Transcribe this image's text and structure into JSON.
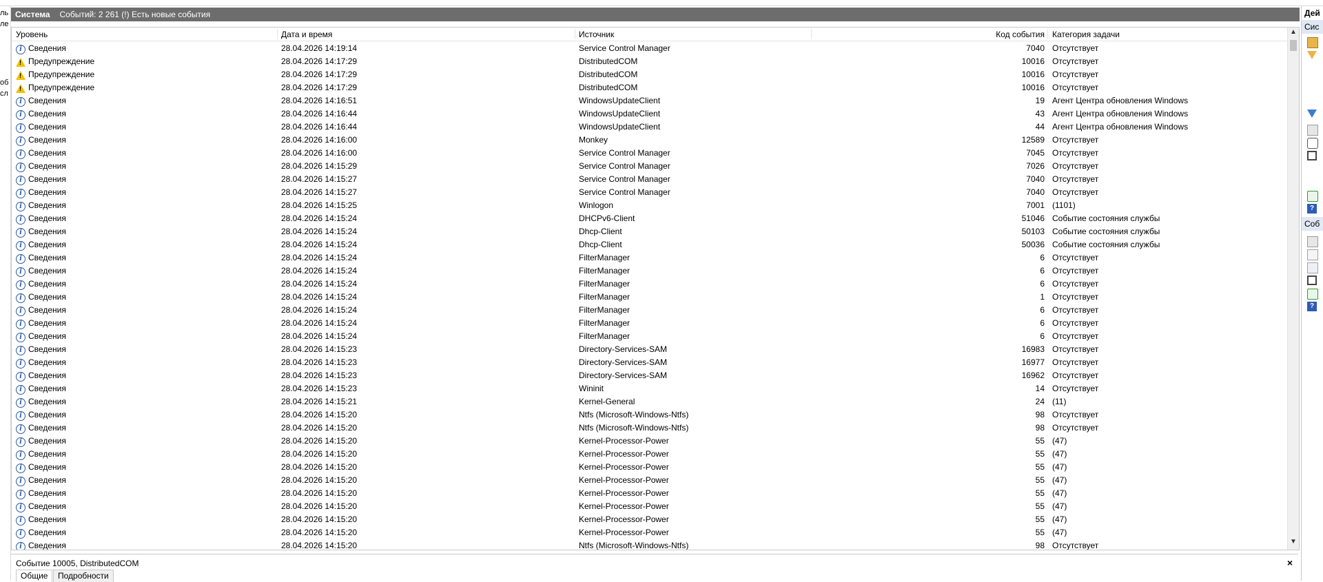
{
  "left_panel": {
    "fragments": [
      "ль",
      "ле",
      "об",
      "сл"
    ]
  },
  "log": {
    "title": "Система",
    "event_count": "Событий: 2 261 (!) Есть новые события"
  },
  "columns": {
    "level": "Уровень",
    "date": "Дата и время",
    "source": "Источник",
    "code": "Код события",
    "category": "Категория задачи"
  },
  "rows": [
    {
      "type": "info",
      "level": "Сведения",
      "date": "28.04.2026 14:19:14",
      "source": "Service Control Manager",
      "code": "7040",
      "category": "Отсутствует"
    },
    {
      "type": "warn",
      "level": "Предупреждение",
      "date": "28.04.2026 14:17:29",
      "source": "DistributedCOM",
      "code": "10016",
      "category": "Отсутствует"
    },
    {
      "type": "warn",
      "level": "Предупреждение",
      "date": "28.04.2026 14:17:29",
      "source": "DistributedCOM",
      "code": "10016",
      "category": "Отсутствует"
    },
    {
      "type": "warn",
      "level": "Предупреждение",
      "date": "28.04.2026 14:17:29",
      "source": "DistributedCOM",
      "code": "10016",
      "category": "Отсутствует"
    },
    {
      "type": "info",
      "level": "Сведения",
      "date": "28.04.2026 14:16:51",
      "source": "WindowsUpdateClient",
      "code": "19",
      "category": "Агент Центра обновления Windows"
    },
    {
      "type": "info",
      "level": "Сведения",
      "date": "28.04.2026 14:16:44",
      "source": "WindowsUpdateClient",
      "code": "43",
      "category": "Агент Центра обновления Windows"
    },
    {
      "type": "info",
      "level": "Сведения",
      "date": "28.04.2026 14:16:44",
      "source": "WindowsUpdateClient",
      "code": "44",
      "category": "Агент Центра обновления Windows"
    },
    {
      "type": "info",
      "level": "Сведения",
      "date": "28.04.2026 14:16:00",
      "source": "Monkey",
      "code": "12589",
      "category": "Отсутствует"
    },
    {
      "type": "info",
      "level": "Сведения",
      "date": "28.04.2026 14:16:00",
      "source": "Service Control Manager",
      "code": "7045",
      "category": "Отсутствует"
    },
    {
      "type": "info",
      "level": "Сведения",
      "date": "28.04.2026 14:15:29",
      "source": "Service Control Manager",
      "code": "7026",
      "category": "Отсутствует"
    },
    {
      "type": "info",
      "level": "Сведения",
      "date": "28.04.2026 14:15:27",
      "source": "Service Control Manager",
      "code": "7040",
      "category": "Отсутствует"
    },
    {
      "type": "info",
      "level": "Сведения",
      "date": "28.04.2026 14:15:27",
      "source": "Service Control Manager",
      "code": "7040",
      "category": "Отсутствует"
    },
    {
      "type": "info",
      "level": "Сведения",
      "date": "28.04.2026 14:15:25",
      "source": "Winlogon",
      "code": "7001",
      "category": "(1101)"
    },
    {
      "type": "info",
      "level": "Сведения",
      "date": "28.04.2026 14:15:24",
      "source": "DHCPv6-Client",
      "code": "51046",
      "category": "Событие состояния службы"
    },
    {
      "type": "info",
      "level": "Сведения",
      "date": "28.04.2026 14:15:24",
      "source": "Dhcp-Client",
      "code": "50103",
      "category": "Событие состояния службы"
    },
    {
      "type": "info",
      "level": "Сведения",
      "date": "28.04.2026 14:15:24",
      "source": "Dhcp-Client",
      "code": "50036",
      "category": "Событие состояния службы"
    },
    {
      "type": "info",
      "level": "Сведения",
      "date": "28.04.2026 14:15:24",
      "source": "FilterManager",
      "code": "6",
      "category": "Отсутствует"
    },
    {
      "type": "info",
      "level": "Сведения",
      "date": "28.04.2026 14:15:24",
      "source": "FilterManager",
      "code": "6",
      "category": "Отсутствует"
    },
    {
      "type": "info",
      "level": "Сведения",
      "date": "28.04.2026 14:15:24",
      "source": "FilterManager",
      "code": "6",
      "category": "Отсутствует"
    },
    {
      "type": "info",
      "level": "Сведения",
      "date": "28.04.2026 14:15:24",
      "source": "FilterManager",
      "code": "1",
      "category": "Отсутствует"
    },
    {
      "type": "info",
      "level": "Сведения",
      "date": "28.04.2026 14:15:24",
      "source": "FilterManager",
      "code": "6",
      "category": "Отсутствует"
    },
    {
      "type": "info",
      "level": "Сведения",
      "date": "28.04.2026 14:15:24",
      "source": "FilterManager",
      "code": "6",
      "category": "Отсутствует"
    },
    {
      "type": "info",
      "level": "Сведения",
      "date": "28.04.2026 14:15:24",
      "source": "FilterManager",
      "code": "6",
      "category": "Отсутствует"
    },
    {
      "type": "info",
      "level": "Сведения",
      "date": "28.04.2026 14:15:23",
      "source": "Directory-Services-SAM",
      "code": "16983",
      "category": "Отсутствует"
    },
    {
      "type": "info",
      "level": "Сведения",
      "date": "28.04.2026 14:15:23",
      "source": "Directory-Services-SAM",
      "code": "16977",
      "category": "Отсутствует"
    },
    {
      "type": "info",
      "level": "Сведения",
      "date": "28.04.2026 14:15:23",
      "source": "Directory-Services-SAM",
      "code": "16962",
      "category": "Отсутствует"
    },
    {
      "type": "info",
      "level": "Сведения",
      "date": "28.04.2026 14:15:23",
      "source": "Wininit",
      "code": "14",
      "category": "Отсутствует"
    },
    {
      "type": "info",
      "level": "Сведения",
      "date": "28.04.2026 14:15:21",
      "source": "Kernel-General",
      "code": "24",
      "category": "(11)"
    },
    {
      "type": "info",
      "level": "Сведения",
      "date": "28.04.2026 14:15:20",
      "source": "Ntfs (Microsoft-Windows-Ntfs)",
      "code": "98",
      "category": "Отсутствует"
    },
    {
      "type": "info",
      "level": "Сведения",
      "date": "28.04.2026 14:15:20",
      "source": "Ntfs (Microsoft-Windows-Ntfs)",
      "code": "98",
      "category": "Отсутствует"
    },
    {
      "type": "info",
      "level": "Сведения",
      "date": "28.04.2026 14:15:20",
      "source": "Kernel-Processor-Power",
      "code": "55",
      "category": "(47)"
    },
    {
      "type": "info",
      "level": "Сведения",
      "date": "28.04.2026 14:15:20",
      "source": "Kernel-Processor-Power",
      "code": "55",
      "category": "(47)"
    },
    {
      "type": "info",
      "level": "Сведения",
      "date": "28.04.2026 14:15:20",
      "source": "Kernel-Processor-Power",
      "code": "55",
      "category": "(47)"
    },
    {
      "type": "info",
      "level": "Сведения",
      "date": "28.04.2026 14:15:20",
      "source": "Kernel-Processor-Power",
      "code": "55",
      "category": "(47)"
    },
    {
      "type": "info",
      "level": "Сведения",
      "date": "28.04.2026 14:15:20",
      "source": "Kernel-Processor-Power",
      "code": "55",
      "category": "(47)"
    },
    {
      "type": "info",
      "level": "Сведения",
      "date": "28.04.2026 14:15:20",
      "source": "Kernel-Processor-Power",
      "code": "55",
      "category": "(47)"
    },
    {
      "type": "info",
      "level": "Сведения",
      "date": "28.04.2026 14:15:20",
      "source": "Kernel-Processor-Power",
      "code": "55",
      "category": "(47)"
    },
    {
      "type": "info",
      "level": "Сведения",
      "date": "28.04.2026 14:15:20",
      "source": "Kernel-Processor-Power",
      "code": "55",
      "category": "(47)"
    },
    {
      "type": "info",
      "level": "Сведения",
      "date": "28.04.2026 14:15:20",
      "source": "Ntfs (Microsoft-Windows-Ntfs)",
      "code": "98",
      "category": "Отсутствует"
    }
  ],
  "detail": {
    "title": "Событие 10005, DistributedCOM",
    "close": "×",
    "tabs": [
      "Общие",
      "Подробности"
    ]
  },
  "actions": {
    "header": "Дей",
    "section1": "Сис",
    "section2": "Соб",
    "help_glyph": "?"
  },
  "icons": {
    "info": "information-icon",
    "warn": "warning-icon",
    "scroll_up": "▲",
    "scroll_down": "▼"
  },
  "colors": {
    "titlebar": "#6d6d6d",
    "section_header": "#dfe8f3",
    "warning": "#f2c200",
    "info": "#2b5aa3"
  }
}
